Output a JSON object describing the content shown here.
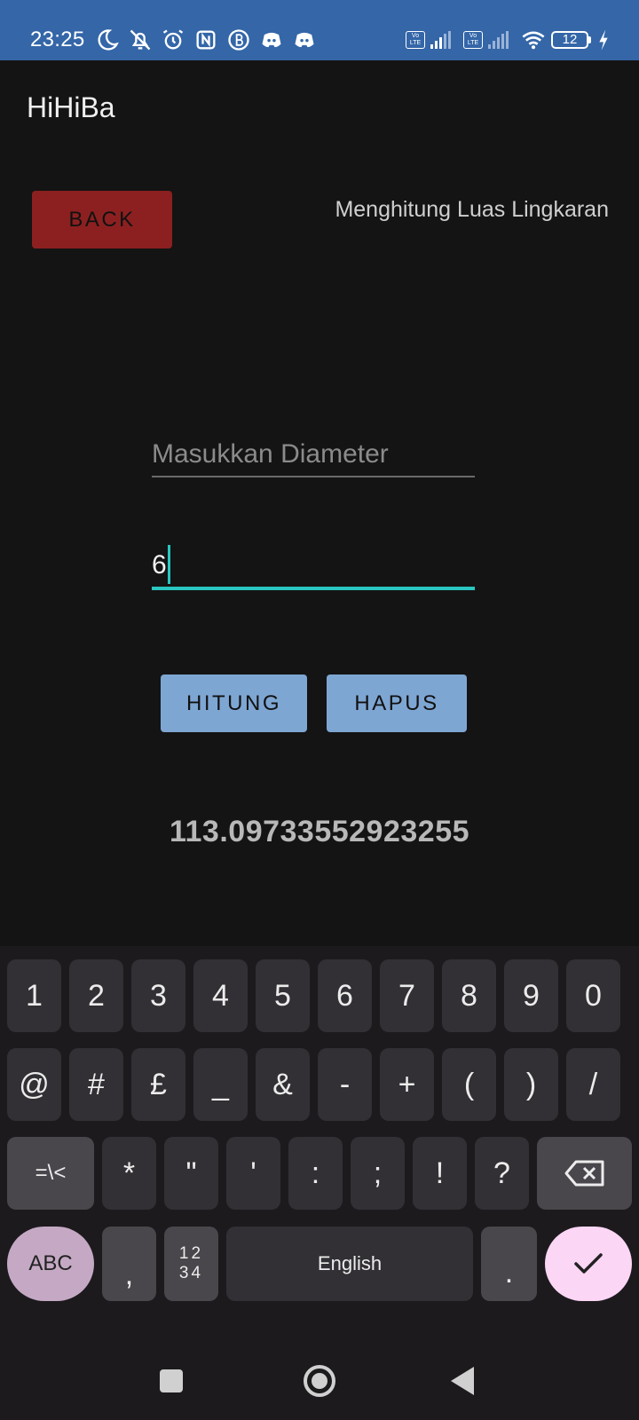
{
  "status_bar": {
    "time": "23:25",
    "volte_label": "Vo LTE",
    "battery_level": "12",
    "icons": [
      "moon-icon",
      "bell-off-icon",
      "alarm-icon",
      "nfc-icon",
      "b-app-icon",
      "discord-icon",
      "discord-icon",
      "volte-icon",
      "signal-icon",
      "volte-icon",
      "signal-icon",
      "wifi-icon",
      "battery-icon",
      "charging-icon"
    ]
  },
  "app": {
    "title": "HiHiBa",
    "back_label": "BACK",
    "heading": "Menghitung Luas Lingkaran",
    "diameter_placeholder": "Masukkan Diameter",
    "input_value": "6",
    "hitung_label": "HITUNG",
    "hapus_label": "HAPUS",
    "result": "113.09733552923255"
  },
  "keyboard": {
    "row1": [
      "1",
      "2",
      "3",
      "4",
      "5",
      "6",
      "7",
      "8",
      "9",
      "0"
    ],
    "row2": [
      "@",
      "#",
      "£",
      "_",
      "&",
      "-",
      "+",
      "(",
      ")",
      "/"
    ],
    "row3": [
      "=\\<",
      "*",
      "\"",
      "'",
      ":",
      ";",
      "!",
      "?"
    ],
    "abc_label": "ABC",
    "comma": ",",
    "numpad_top": "12",
    "numpad_bottom": "34",
    "space_label": "English",
    "period": ".",
    "colors": {
      "key": "#323034",
      "fn_key": "#4a474c",
      "abc_key": "#c5a9c4",
      "enter_key": "#fbd6f5"
    }
  },
  "colors": {
    "status_bar": "#3466a8",
    "background": "#141414",
    "back_button": "#8c2020",
    "action_button": "#7ea6d3",
    "focus_accent": "#2ac6c0"
  }
}
